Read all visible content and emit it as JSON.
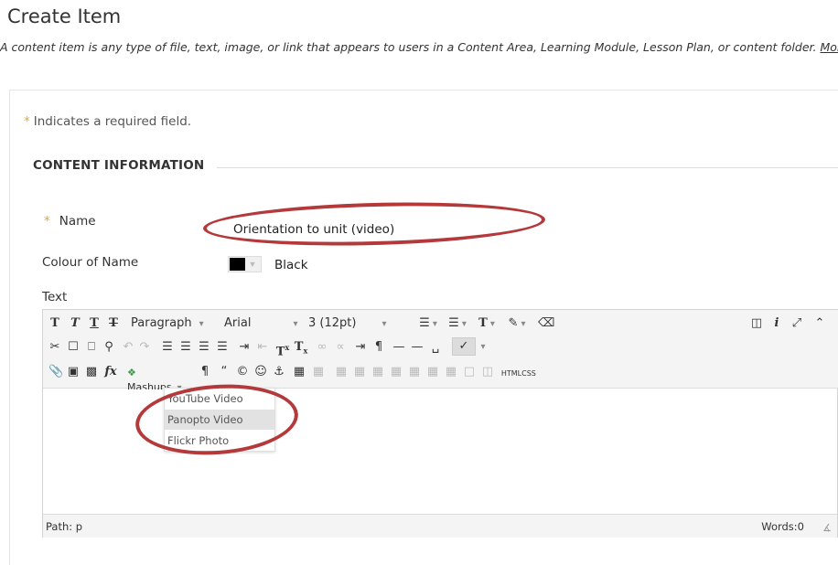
{
  "page": {
    "title": "Create Item",
    "description": "A content item is any type of file, text, image, or link that appears to users in a Content Area, Learning Module, Lesson Plan, or content folder.",
    "help_link": "More Help"
  },
  "form": {
    "required_star": "*",
    "required_note": "Indicates a required field.",
    "section_title": "CONTENT INFORMATION",
    "name_label": "Name",
    "name_value": "Orientation to unit (video)",
    "colour_label": "Colour of Name",
    "colour_value": "Black",
    "colour_hex": "#000000",
    "text_label": "Text"
  },
  "editor": {
    "row1": {
      "t_bold": "T",
      "t_italic": "T",
      "t_underline": "T",
      "t_strike": "T",
      "format": "Paragraph",
      "font": "Arial",
      "size": "3 (12pt)",
      "text_colour": "T"
    },
    "row3": {
      "fx": "fx",
      "mashups": "Mashups",
      "pilcrow": "¶",
      "quote": "“",
      "html": "HTML",
      "css": "CSS"
    },
    "status": {
      "path": "Path: p",
      "words": "Words:0"
    }
  },
  "mashups_menu": {
    "items": [
      "YouTube Video",
      "Panopto Video",
      "Flickr Photo"
    ],
    "highlighted": "Panopto Video"
  },
  "colors": {
    "annotation": "#b4393b",
    "required": "#e8a33a"
  }
}
